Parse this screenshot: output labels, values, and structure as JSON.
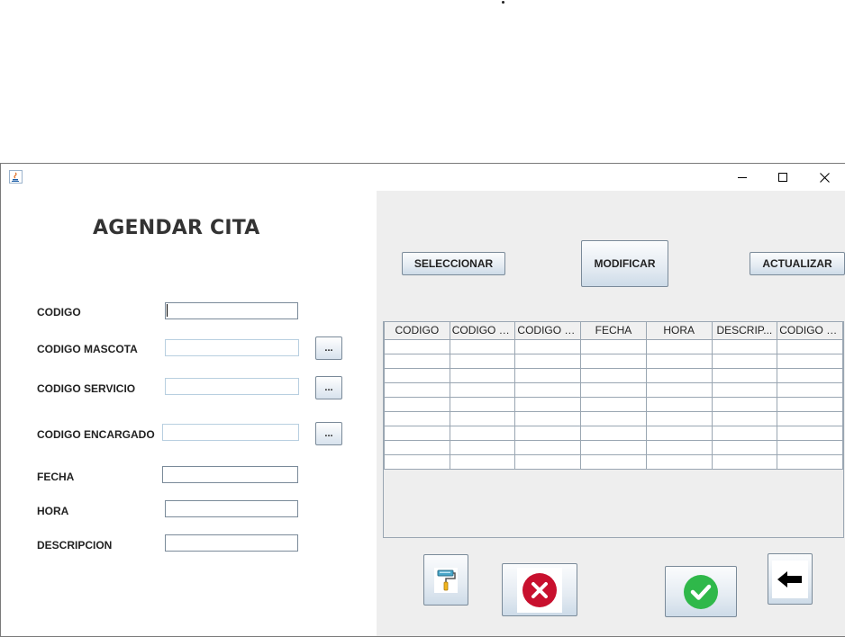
{
  "window": {
    "icon": "java-cup-icon",
    "controls": {
      "minimize": "minimize-icon",
      "maximize": "maximize-icon",
      "close": "close-icon"
    }
  },
  "form": {
    "title": "AGENDAR CITA",
    "fields": {
      "codigo": {
        "label": "CODIGO",
        "value": ""
      },
      "codigo_mascota": {
        "label": "CODIGO MASCOTA",
        "value": ""
      },
      "codigo_servicio": {
        "label": "CODIGO SERVICIO",
        "value": ""
      },
      "codigo_encargado": {
        "label": "CODIGO ENCARGADO",
        "value": ""
      },
      "fecha": {
        "label": "FECHA",
        "value": ""
      },
      "hora": {
        "label": "HORA",
        "value": ""
      },
      "descripcion": {
        "label": "DESCRIPCION",
        "value": ""
      }
    },
    "browse_label": "..."
  },
  "actions": {
    "seleccionar": "SELECCIONAR",
    "modificar": "MODIFICAR",
    "actualizar": "ACTUALIZAR"
  },
  "table": {
    "columns": [
      "CODIGO",
      "CODIGO M...",
      "CODIGO S...",
      "FECHA",
      "HORA",
      "DESCRIP...",
      "CODIGO V..."
    ],
    "row_count": 9
  },
  "bottom_icons": [
    "paint-roller-icon",
    "cancel-x-icon",
    "check-icon",
    "back-arrow-icon"
  ],
  "colors": {
    "cancel_red": "#c8102e",
    "confirm_green": "#2fb84a"
  }
}
